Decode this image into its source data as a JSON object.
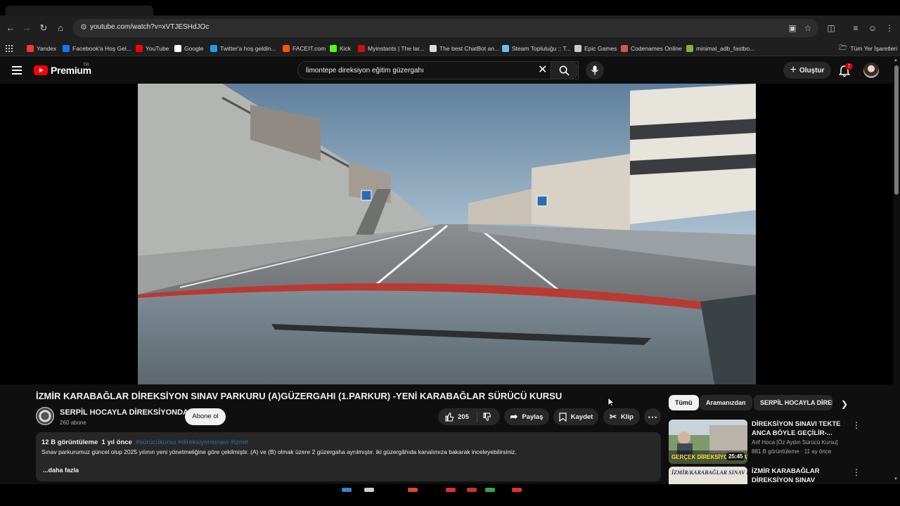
{
  "browser": {
    "url": "youtube.com/watch?v=xVTJESHdJOc",
    "bookmarks": [
      {
        "label": "Yandex",
        "color": "#ff3333",
        "icon": "yandex-icon"
      },
      {
        "label": "Facebook'a Hoş Gel...",
        "color": "#1877f2",
        "icon": "facebook-icon"
      },
      {
        "label": "YouTube",
        "color": "#ff0000",
        "icon": "youtube-icon"
      },
      {
        "label": "Google",
        "color": "#ffffff",
        "icon": "google-icon"
      },
      {
        "label": "Twitter'a hoş geldin...",
        "color": "#1d9bf0",
        "icon": "twitter-icon"
      },
      {
        "label": "FACEIT.com",
        "color": "#ff5500",
        "icon": "faceit-icon"
      },
      {
        "label": "Kick",
        "color": "#53fc18",
        "icon": "kick-icon"
      },
      {
        "label": "Myinstants | The lar...",
        "color": "#cc1111",
        "icon": "myinstants-icon"
      },
      {
        "label": "The best ChatBot an...",
        "color": "#dddddd",
        "icon": "chatbot-icon"
      },
      {
        "label": "Steam Topluluğu :: T...",
        "color": "#66c0f4",
        "icon": "steam-icon"
      },
      {
        "label": "Epic Games",
        "color": "#cccccc",
        "icon": "epic-icon"
      },
      {
        "label": "Codenames Online",
        "color": "#d9534f",
        "icon": "codenames-icon"
      },
      {
        "label": "minimal_adb_fastbo...",
        "color": "#7cb342",
        "icon": "drive-icon"
      }
    ],
    "all_bookmarks_label": "Tüm Yer İşaretleri"
  },
  "youtube": {
    "logo_text": "Premium",
    "country_code": "TR",
    "search_query": "limontepe direksiyon eğitim güzergahı",
    "create_label": "Oluştur",
    "notification_count": "7"
  },
  "video": {
    "title": "İZMİR KARABAĞLAR DİREKSİYON SINAV PARKURU (A)GÜZERGAHI (1.PARKUR) -YENİ KARABAĞLAR SÜRÜCÜ KURSU",
    "channel_name": "SERPİL HOCAYLA DİREKSİYONDA",
    "subscribers": "260 abone",
    "subscribe_label": "Abone ol",
    "likes": "205",
    "share_label": "Paylaş",
    "save_label": "Kaydet",
    "clip_label": "Klip",
    "description": {
      "views": "12 B görüntüleme",
      "age": "1 yıl önce",
      "tags": "#sürücükursu #direksiyonsinavi #izmir",
      "text": "Sınav parkurumuz  güncel olup 2025 yılının yeni yönetmeliğine göre çekilmiştir. (A) ve (B) olmak üzere 2 güzergaha ayrılmıştır. iki güzergâhıda kanalımıza bakarak inceleyebilirsiniz.",
      "more_label": "...daha fazla"
    }
  },
  "chips": [
    "Tümü",
    "Aramanızdan",
    "SERPİL HOCAYLA DİREKSİYONDA"
  ],
  "recommendations": [
    {
      "title": "DİREKSİYON SINAVI TEKTE ANCA BÖYLE GEÇİLİR-...",
      "channel": "Arif Hoca [Öz Aydın Sürücü Kursu]",
      "meta": "881 B görüntüleme · 11 ay önce",
      "duration": "25:45",
      "thumb_caption": "GERÇEK DİREKSİYON SINAVI"
    },
    {
      "title": "İZMİR KARABAĞLAR DİREKSİYON SINAV PARKURU ...",
      "channel": "",
      "meta": "",
      "duration": "",
      "thumb_caption": "İZMİR/KARABAĞLAR SINAV PARKUR"
    }
  ]
}
